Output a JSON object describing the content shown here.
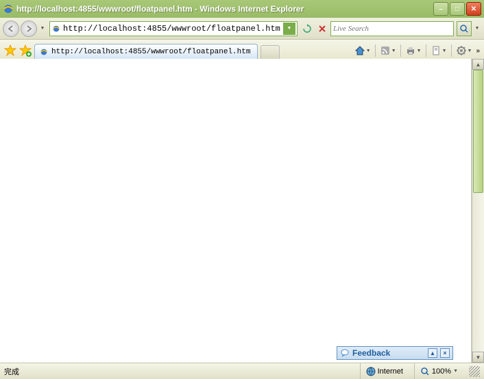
{
  "window": {
    "title": "http://localhost:4855/wwwroot/floatpanel.htm - Windows Internet Explorer"
  },
  "nav": {
    "address": "http://localhost:4855/wwwroot/floatpanel.htm",
    "search_placeholder": "Live Search"
  },
  "tab": {
    "label": "http://localhost:4855/wwwroot/floatpanel.htm"
  },
  "float_panel": {
    "title": "Feedback"
  },
  "status": {
    "done": "完成",
    "zone": "Internet",
    "zoom": "100%"
  }
}
